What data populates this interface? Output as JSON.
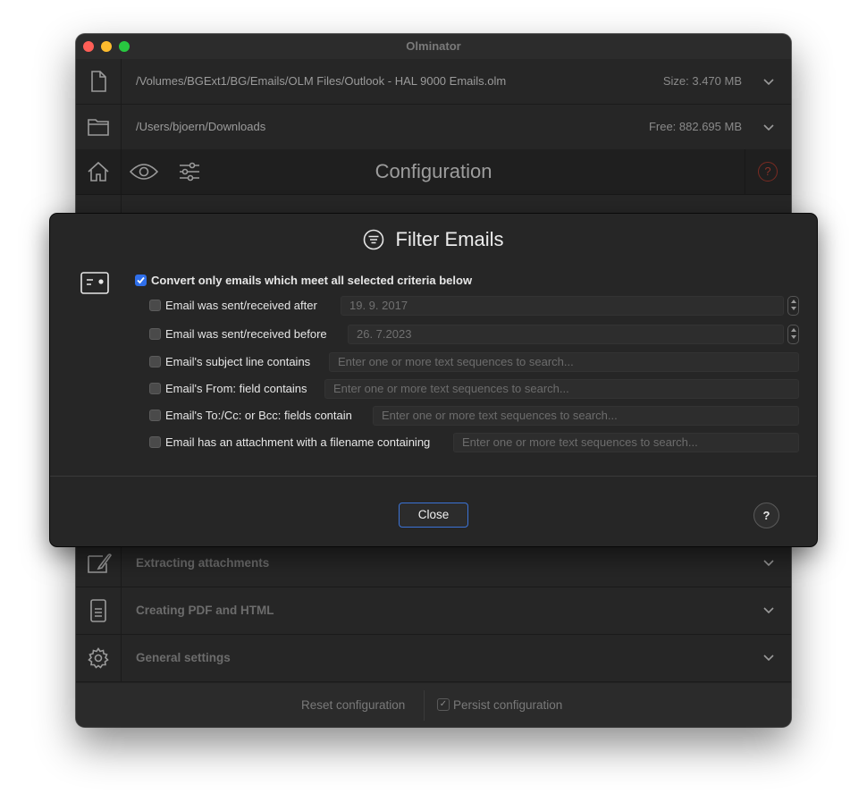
{
  "window": {
    "title": "Olminator"
  },
  "source": {
    "path": "/Volumes/BGExt1/BG/Emails/OLM Files/Outlook - HAL 9000 Emails.olm",
    "info": "Size: 3.470 MB"
  },
  "destination": {
    "path": "/Users/bjoern/Downloads",
    "info": "Free: 882.695 MB"
  },
  "toolbar": {
    "title": "Configuration",
    "help_icon": "?"
  },
  "sections": [
    {
      "label": "Extracting attachments",
      "icon": "attachment-icon"
    },
    {
      "label": "Creating PDF and HTML",
      "icon": "document-icon"
    },
    {
      "label": "General settings",
      "icon": "gear-icon"
    }
  ],
  "footer": {
    "reset_label": "Reset configuration",
    "persist_label": "Persist configuration",
    "persist_checked": true
  },
  "sheet": {
    "title": "Filter Emails",
    "master": {
      "label": "Convert only emails which meet all selected criteria below",
      "checked": true
    },
    "after": {
      "label": "Email was sent/received after",
      "value": "19. 9. 2017"
    },
    "before": {
      "label": "Email was sent/received before",
      "value": "26. 7.2023"
    },
    "subject": {
      "label": "Email's subject line contains",
      "placeholder": "Enter one or more text sequences to search..."
    },
    "from": {
      "label": "Email's From: field contains",
      "placeholder": "Enter one or more text sequences to search..."
    },
    "tocc": {
      "label": "Email's To:/Cc: or Bcc: fields contain",
      "placeholder": "Enter one or more text sequences to search..."
    },
    "attachment": {
      "label": "Email has an attachment with a filename containing",
      "placeholder": "Enter one or more text sequences to search..."
    },
    "close_label": "Close",
    "help_label": "?"
  },
  "colors": {
    "accent": "#2f6fea",
    "window_bg": "#232323",
    "danger": "#b23a2a"
  }
}
